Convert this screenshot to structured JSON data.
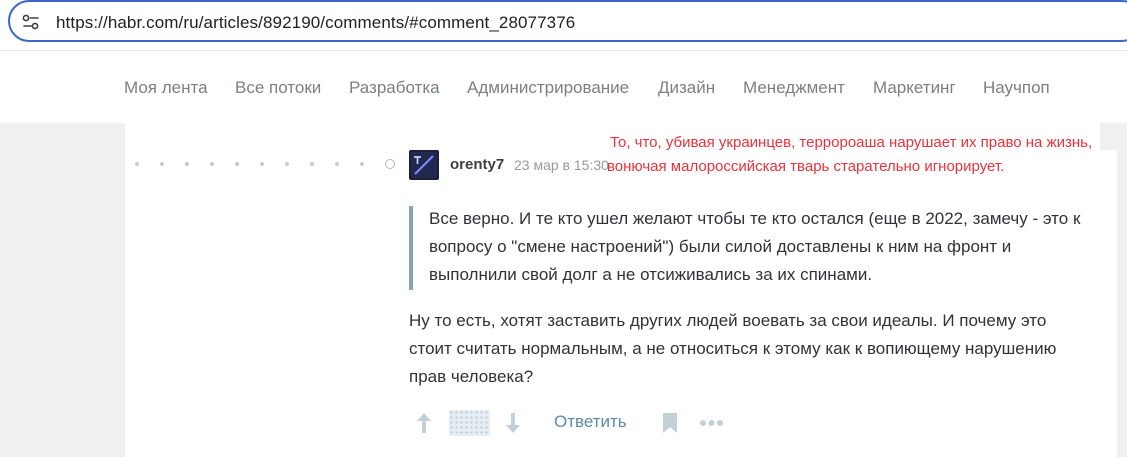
{
  "browser": {
    "url": "https://habr.com/ru/articles/892190/comments/#comment_28077376"
  },
  "nav": {
    "items": [
      "Моя лента",
      "Все потоки",
      "Разработка",
      "Администрирование",
      "Дизайн",
      "Менеджмент",
      "Маркетинг",
      "Научпоп"
    ]
  },
  "comment": {
    "username": "orenty7",
    "date": "23 мар в 15:30",
    "quote": "Все верно. И те кто ушел желают чтобы те кто остался (еще в 2022, замечу - это к вопросу о \"смене настроений\") были силой доставлены к ним на фронт и выполнили свой долг а не отсиживались за их спинами.",
    "text": "Ну то есть, хотят заставить других людей воевать за свои идеалы. И почему это стоит считать нормальным, а не относиться к этому как к вопиющему нарушению прав человека?",
    "actions": {
      "reply_label": "Ответить"
    }
  },
  "overlay": {
    "line1": "То, что, убивая украинцев, терророаша нарушает их право на жизнь,",
    "line2": "вонючая малороссийская тварь старательно игнорирует."
  },
  "colors": {
    "addressbar_border": "#3867c9",
    "nav_text": "#7b8084",
    "overlay_text": "#e8333c",
    "quote_bar": "#7fa5b6",
    "reply_link": "#5e8ba8",
    "page_bg": "#f0f0f0"
  },
  "icons": [
    "site-settings-icon",
    "avatar-image",
    "vote-up-icon",
    "vote-down-icon",
    "bookmark-icon",
    "more-options-icon"
  ]
}
